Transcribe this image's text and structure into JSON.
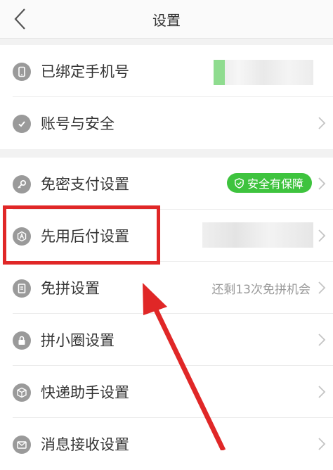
{
  "header": {
    "title": "设置"
  },
  "settings": {
    "items": [
      {
        "label": "已绑定手机号",
        "icon": "phone-icon"
      },
      {
        "label": "账号与安全",
        "icon": "shield-check-icon"
      },
      {
        "label": "免密支付设置",
        "icon": "key-icon",
        "badge": "安全有保障"
      },
      {
        "label": "先用后付设置",
        "icon": "badge-a-icon"
      },
      {
        "label": "免拼设置",
        "icon": "doc-icon",
        "right_text": "还剩13次免拼机会"
      },
      {
        "label": "拼小圈设置",
        "icon": "lock-icon"
      },
      {
        "label": "快递助手设置",
        "icon": "package-icon"
      },
      {
        "label": "消息接收设置",
        "icon": "mail-icon"
      }
    ]
  },
  "colors": {
    "badge_green": "#3ec33e",
    "highlight_red": "#e02727",
    "icon_gray": "#9a9a9a"
  }
}
